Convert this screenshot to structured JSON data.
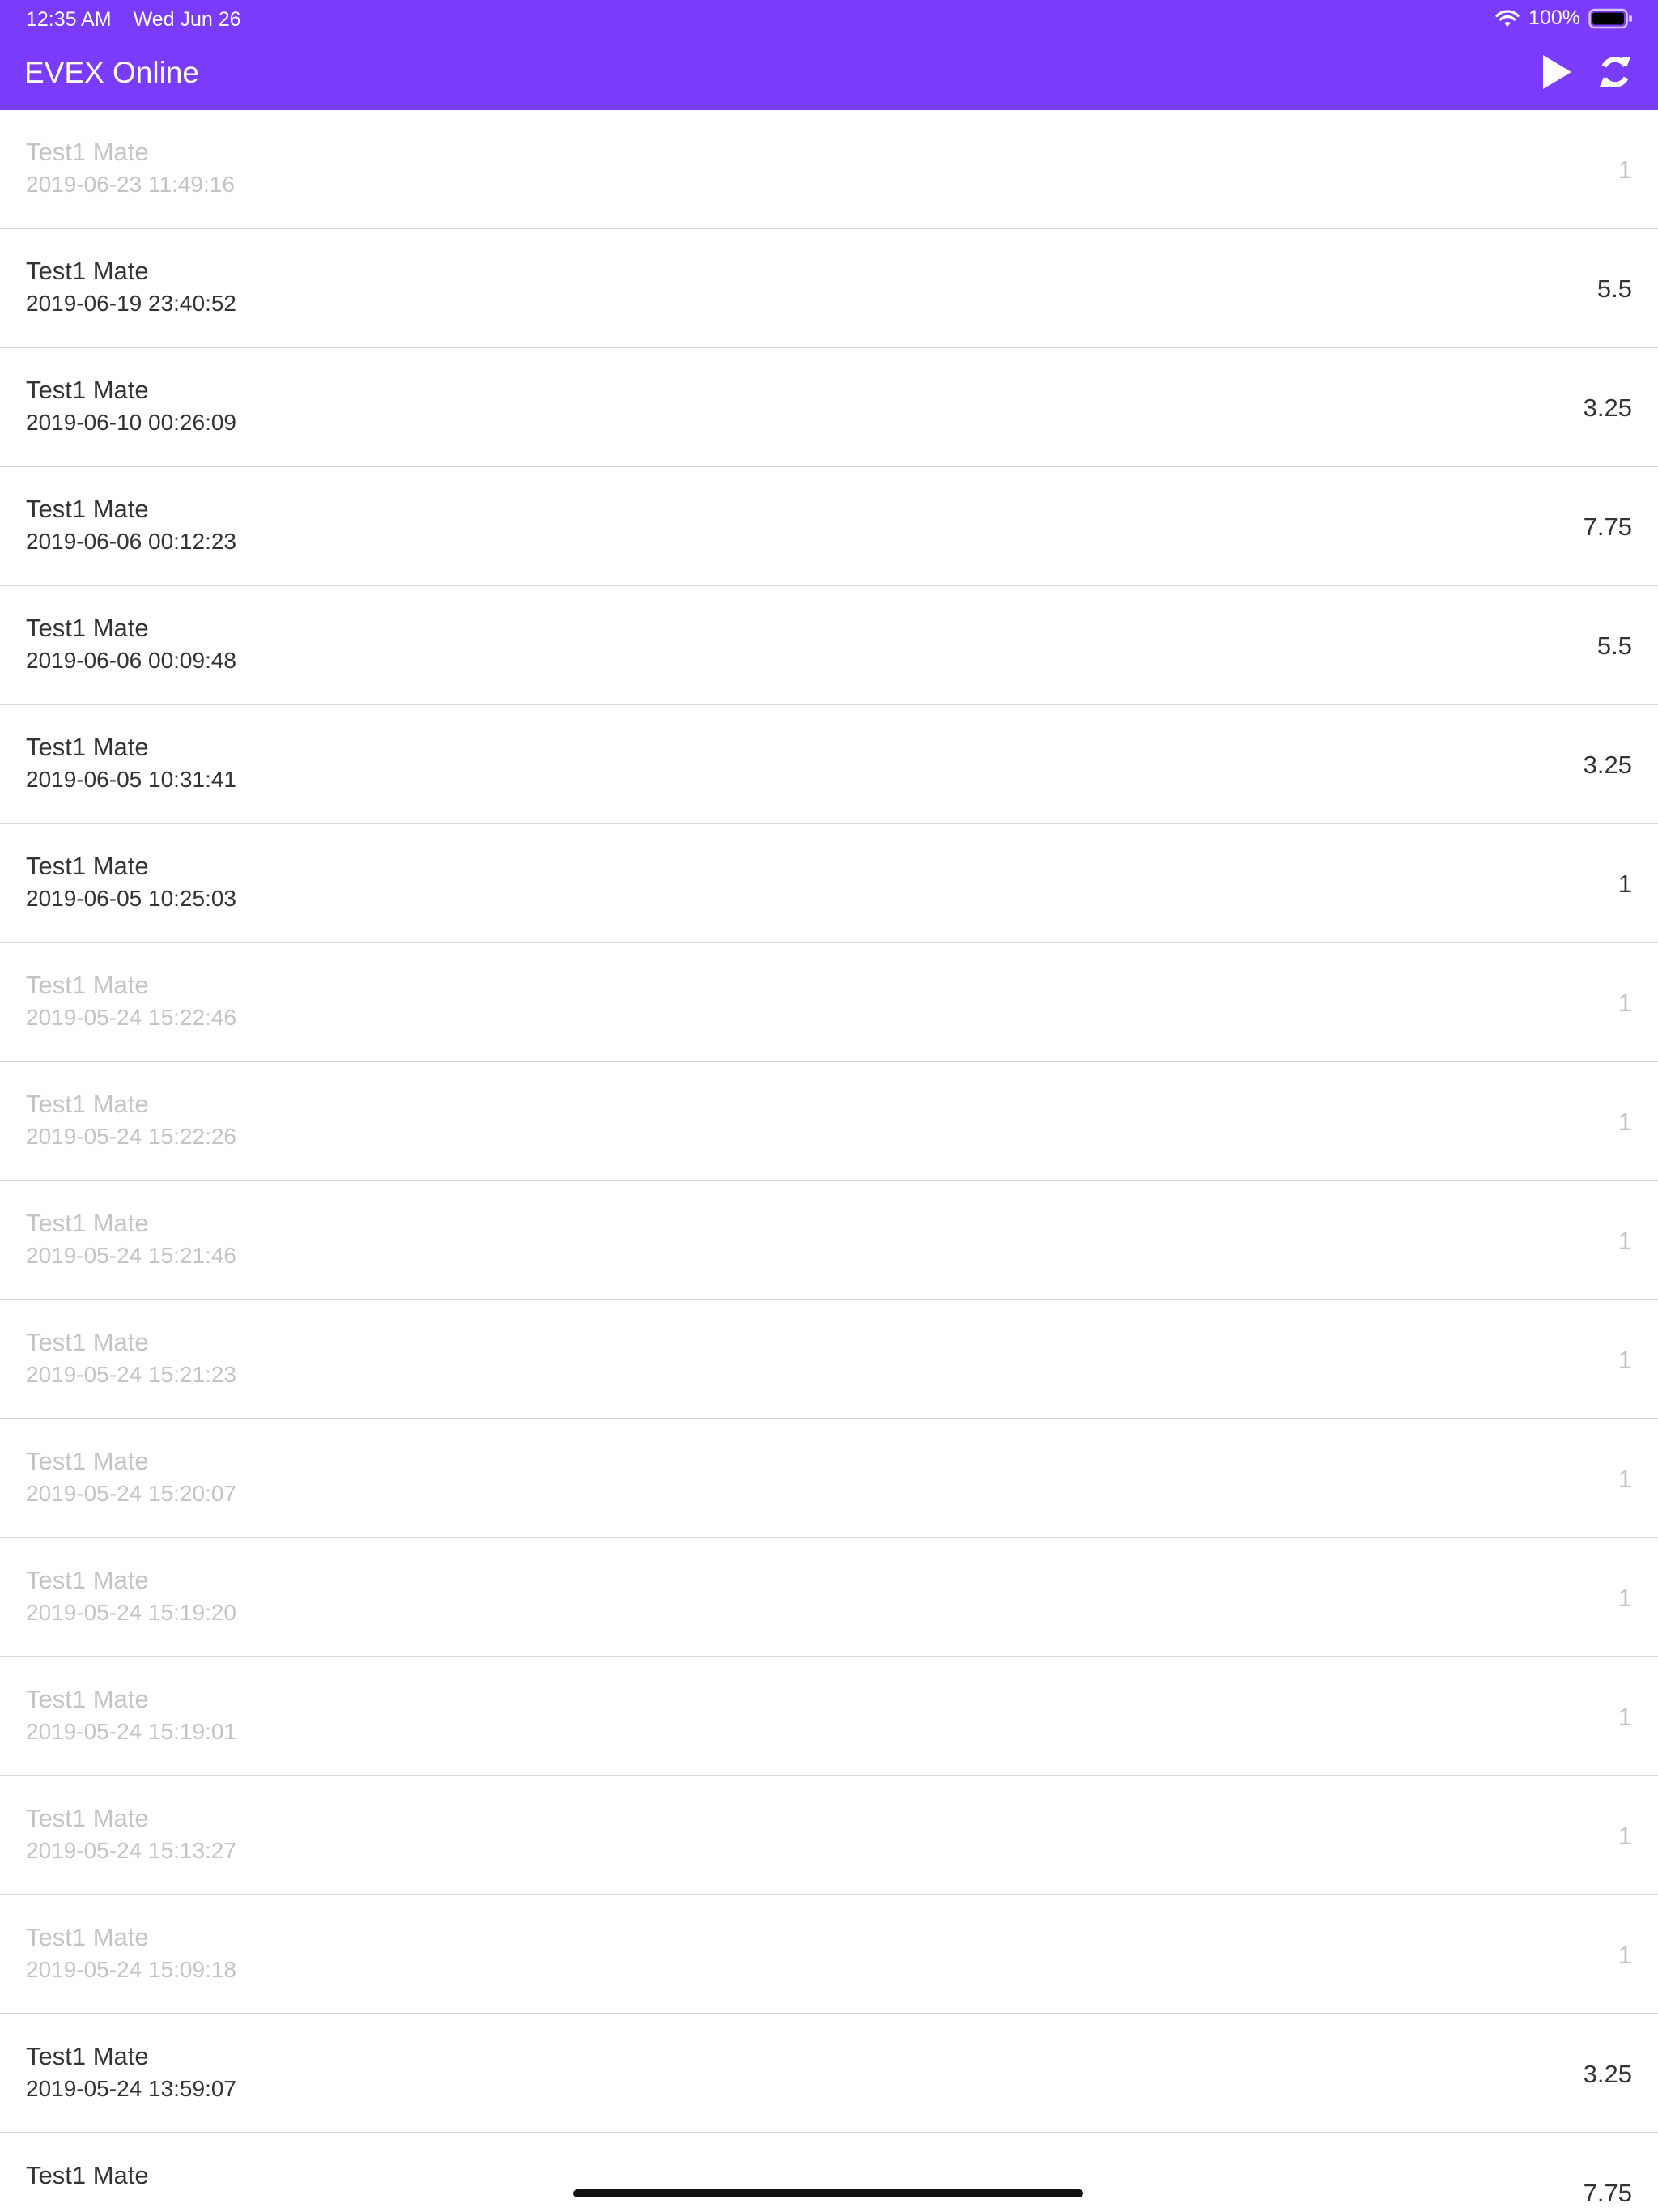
{
  "status_bar": {
    "time": "12:35 AM",
    "date": "Wed Jun 26",
    "battery": "100%"
  },
  "header": {
    "title": "EVEX Online",
    "actions": [
      "play-icon",
      "refresh-icon"
    ]
  },
  "colors": {
    "header_bg": "#7b3bfb",
    "text": "#333333",
    "muted_text": "#c4c4c4",
    "divider": "#d6d6d6"
  },
  "items": [
    {
      "name": "Test1 Mate",
      "date": "2019-06-23 11:49:16",
      "value": "1",
      "muted": true
    },
    {
      "name": "Test1 Mate",
      "date": "2019-06-19 23:40:52",
      "value": "5.5",
      "muted": false
    },
    {
      "name": "Test1 Mate",
      "date": "2019-06-10 00:26:09",
      "value": "3.25",
      "muted": false
    },
    {
      "name": "Test1 Mate",
      "date": "2019-06-06 00:12:23",
      "value": "7.75",
      "muted": false
    },
    {
      "name": "Test1 Mate",
      "date": "2019-06-06 00:09:48",
      "value": "5.5",
      "muted": false
    },
    {
      "name": "Test1 Mate",
      "date": "2019-06-05 10:31:41",
      "value": "3.25",
      "muted": false
    },
    {
      "name": "Test1 Mate",
      "date": "2019-06-05 10:25:03",
      "value": "1",
      "muted": false
    },
    {
      "name": "Test1 Mate",
      "date": "2019-05-24 15:22:46",
      "value": "1",
      "muted": true
    },
    {
      "name": "Test1 Mate",
      "date": "2019-05-24 15:22:26",
      "value": "1",
      "muted": true
    },
    {
      "name": "Test1 Mate",
      "date": "2019-05-24 15:21:46",
      "value": "1",
      "muted": true
    },
    {
      "name": "Test1 Mate",
      "date": "2019-05-24 15:21:23",
      "value": "1",
      "muted": true
    },
    {
      "name": "Test1 Mate",
      "date": "2019-05-24 15:20:07",
      "value": "1",
      "muted": true
    },
    {
      "name": "Test1 Mate",
      "date": "2019-05-24 15:19:20",
      "value": "1",
      "muted": true
    },
    {
      "name": "Test1 Mate",
      "date": "2019-05-24 15:19:01",
      "value": "1",
      "muted": true
    },
    {
      "name": "Test1 Mate",
      "date": "2019-05-24 15:13:27",
      "value": "1",
      "muted": true
    },
    {
      "name": "Test1 Mate",
      "date": "2019-05-24 15:09:18",
      "value": "1",
      "muted": true
    },
    {
      "name": "Test1 Mate",
      "date": "2019-05-24 13:59:07",
      "value": "3.25",
      "muted": false
    },
    {
      "name": "Test1 Mate",
      "date": "",
      "value": "7.75",
      "muted": false
    }
  ]
}
